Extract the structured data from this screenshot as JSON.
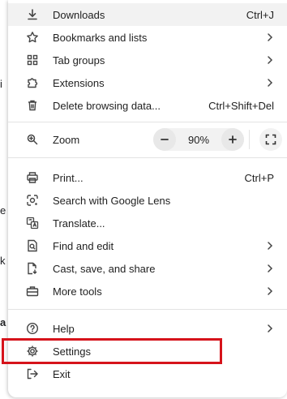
{
  "menu": {
    "downloads": {
      "label": "Downloads",
      "shortcut": "Ctrl+J",
      "icon": "download-icon"
    },
    "bookmarks": {
      "label": "Bookmarks and lists",
      "icon": "star-icon"
    },
    "tab_groups": {
      "label": "Tab groups",
      "icon": "grid-icon"
    },
    "extensions": {
      "label": "Extensions",
      "icon": "puzzle-icon"
    },
    "delete_browsing": {
      "label": "Delete browsing data...",
      "shortcut": "Ctrl+Shift+Del",
      "icon": "trash-icon"
    },
    "zoom": {
      "label": "Zoom",
      "value": "90%",
      "icon": "zoom-icon"
    },
    "print": {
      "label": "Print...",
      "shortcut": "Ctrl+P",
      "icon": "printer-icon"
    },
    "lens": {
      "label": "Search with Google Lens",
      "icon": "lens-icon"
    },
    "translate": {
      "label": "Translate...",
      "icon": "translate-icon"
    },
    "find_edit": {
      "label": "Find and edit",
      "icon": "find-icon"
    },
    "cast_save": {
      "label": "Cast, save, and share",
      "icon": "cast-icon"
    },
    "more_tools": {
      "label": "More tools",
      "icon": "toolbox-icon"
    },
    "help": {
      "label": "Help",
      "icon": "help-icon"
    },
    "settings": {
      "label": "Settings",
      "icon": "gear-icon"
    },
    "exit": {
      "label": "Exit",
      "icon": "exit-icon"
    }
  },
  "colors": {
    "highlight_box": "#d6131b",
    "hover_bg": "#f2f2f2",
    "separator": "#e3e3e3"
  }
}
